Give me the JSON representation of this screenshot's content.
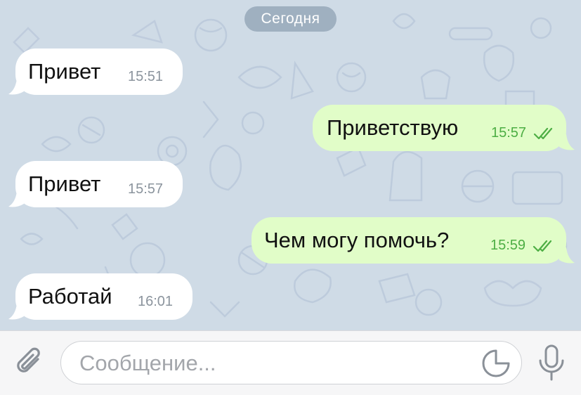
{
  "chat": {
    "date_divider": "Сегодня",
    "messages": [
      {
        "direction": "in",
        "text": "Привет",
        "time": "15:51"
      },
      {
        "direction": "out",
        "text": "Приветствую",
        "time": "15:57",
        "status": "read"
      },
      {
        "direction": "in",
        "text": "Привет",
        "time": "15:57"
      },
      {
        "direction": "out",
        "text": "Чем могу помочь?",
        "time": "15:59",
        "status": "read"
      },
      {
        "direction": "in",
        "text": "Работай",
        "time": "16:01"
      }
    ]
  },
  "composer": {
    "placeholder": "Сообщение...",
    "value": ""
  },
  "icons": {
    "attach": "paperclip-icon",
    "sticker": "sticker-icon",
    "mic": "microphone-icon",
    "read_status": "double-check-icon"
  },
  "colors": {
    "outgoing_bubble": "#e1fdc8",
    "incoming_bubble": "#ffffff",
    "outgoing_time": "#4dae44",
    "incoming_time": "#8b949d",
    "wallpaper": "#cfdbe6"
  }
}
